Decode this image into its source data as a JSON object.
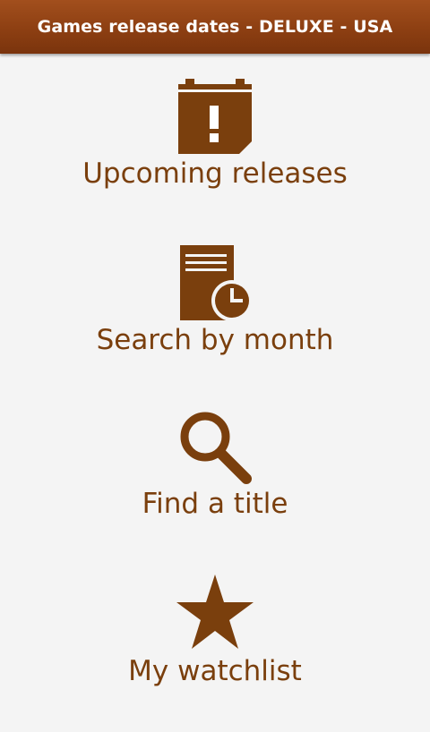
{
  "app": {
    "title": "Games release dates - DELUXE - USA"
  },
  "menu": {
    "items": [
      {
        "label": "Upcoming releases",
        "icon": "calendar-alert-icon"
      },
      {
        "label": "Search by month",
        "icon": "document-clock-icon"
      },
      {
        "label": "Find a title",
        "icon": "magnifier-icon"
      },
      {
        "label": "My watchlist",
        "icon": "star-icon"
      }
    ]
  },
  "colors": {
    "title_bar": "#8d3f12",
    "accent": "#7a3f0d",
    "background": "#f4f4f4"
  }
}
